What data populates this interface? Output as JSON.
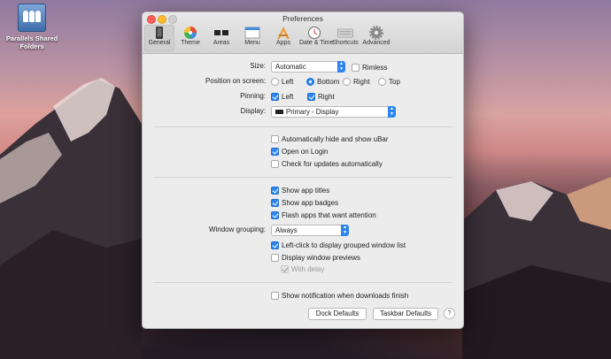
{
  "desktop": {
    "icon_label": "Parallels Shared Folders"
  },
  "window": {
    "title": "Preferences",
    "tabs": [
      {
        "label": "General",
        "icon": "phone-icon",
        "selected": true
      },
      {
        "label": "Theme",
        "icon": "color-wheel-icon",
        "selected": false
      },
      {
        "label": "Areas",
        "icon": "areas-icon",
        "selected": false
      },
      {
        "label": "Menu",
        "icon": "menu-icon",
        "selected": false
      },
      {
        "label": "Apps",
        "icon": "apps-icon",
        "selected": false
      },
      {
        "label": "Date & Time",
        "icon": "clock-icon",
        "selected": false
      },
      {
        "label": "Shortcuts",
        "icon": "keyboard-icon",
        "selected": false
      },
      {
        "label": "Advanced",
        "icon": "gear-icon",
        "selected": false
      }
    ]
  },
  "general": {
    "size_label": "Size:",
    "size_value": "Automatic",
    "rimless_label": "Rimless",
    "position_label": "Position on screen:",
    "position_options": [
      "Left",
      "Bottom",
      "Right",
      "Top"
    ],
    "position_selected": "Bottom",
    "pinning_label": "Pinning:",
    "pinning_left": "Left",
    "pinning_right": "Right",
    "display_label": "Display:",
    "display_value": "Primary - Display",
    "auto_hide": "Automatically hide and show uBar",
    "open_login": "Open on Login",
    "check_updates": "Check for updates automatically",
    "show_titles": "Show app titles",
    "show_badges": "Show app badges",
    "flash_apps": "Flash apps that want attention",
    "grouping_label": "Window grouping:",
    "grouping_value": "Always",
    "left_click": "Left-click to display grouped window list",
    "display_previews": "Display window previews",
    "with_delay": "With delay",
    "show_notification": "Show notification when downloads finish",
    "dock_defaults": "Dock Defaults",
    "taskbar_defaults": "Taskbar Defaults",
    "help": "?"
  },
  "colors": {
    "accent": "#2d86f0"
  }
}
